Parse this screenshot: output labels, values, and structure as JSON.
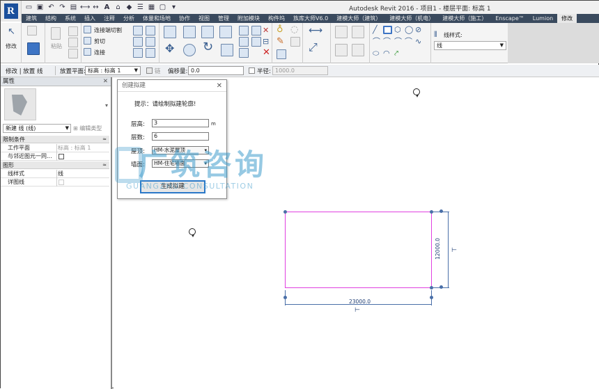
{
  "window": {
    "title": "Autodesk Revit 2016 -    项目1 - 楼层平面: 标高 1"
  },
  "ribbon_tabs": [
    "建筑",
    "结构",
    "系统",
    "插入",
    "注释",
    "分析",
    "体量和场地",
    "协作",
    "视图",
    "管理",
    "附加模块",
    "构件坞",
    "族库大师V6.0",
    "建模大师（建筑）",
    "建模大师（机电）",
    "建模大师（施工）",
    "Enscape™",
    "Lumion",
    "修改"
  ],
  "active_tab": "修改",
  "ribbon": {
    "modify_label": "修改",
    "paste_label": "粘贴",
    "join_cut_label": "连接端切割",
    "cut_label": "剪切",
    "join_label": "连接",
    "line_style_label": "线样式:",
    "line_style_value": "线"
  },
  "options_bar": {
    "context": "修改 | 放置 线",
    "placement_plane_label": "放置平面:",
    "placement_plane_value": "标高 : 标高 1",
    "chain_label": "链",
    "offset_label": "偏移量:",
    "offset_value": "0.0",
    "radius_label": "半径:",
    "radius_value": "1000.0"
  },
  "properties": {
    "header": "属性",
    "type_value": "新建 线 (线)",
    "edit_type_label": "编辑类型",
    "sections": [
      {
        "title": "限制条件",
        "rows": [
          {
            "key": "工作平面",
            "value": "标高 : 标高 1"
          },
          {
            "key": "与邻近图元一同...",
            "value": ""
          }
        ]
      },
      {
        "title": "图形",
        "rows": [
          {
            "key": "线样式",
            "value": "线"
          },
          {
            "key": "详图线",
            "value": ""
          }
        ]
      }
    ]
  },
  "dialog": {
    "title": "创建拟建",
    "hint": "提示：请绘制拟建轮廓!",
    "floor_height_label": "层高:",
    "floor_height_value": "3",
    "floor_height_unit": "m",
    "floor_count_label": "层数:",
    "floor_count_value": "6",
    "roof_label": "屋顶:",
    "roof_value": "HM-水泥屋顶",
    "wall_label": "墙面:",
    "wall_value": "HM-住宅墙面",
    "generate_button": "生成拟建"
  },
  "watermark": {
    "cn": "广筑咨询",
    "en": "GUANGZHU CONSULTATION"
  },
  "drawing": {
    "width_dim": "23000.0",
    "height_dim": "12000.0",
    "outline_color": "#e040e0",
    "dim_color": "#4a6fa8"
  }
}
